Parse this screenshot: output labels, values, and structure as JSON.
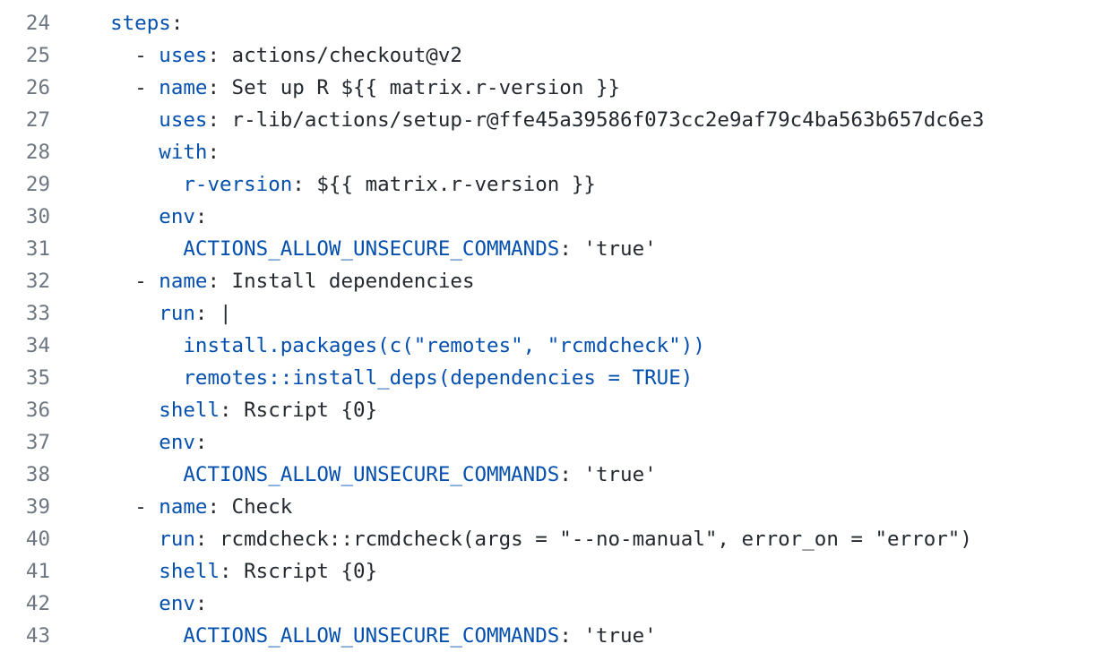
{
  "editor": {
    "lines": [
      {
        "number": "24",
        "indent": "  ",
        "tokens": [
          {
            "t": "steps",
            "k": "key"
          },
          {
            "t": ":",
            "k": "punct"
          }
        ]
      },
      {
        "number": "25",
        "indent": "    ",
        "tokens": [
          {
            "t": "- ",
            "k": "punct"
          },
          {
            "t": "uses",
            "k": "key"
          },
          {
            "t": ": actions/checkout@v2",
            "k": "text"
          }
        ]
      },
      {
        "number": "26",
        "indent": "    ",
        "tokens": [
          {
            "t": "- ",
            "k": "punct"
          },
          {
            "t": "name",
            "k": "key"
          },
          {
            "t": ": Set up R ${{ matrix.r-version }}",
            "k": "text"
          }
        ]
      },
      {
        "number": "27",
        "indent": "      ",
        "tokens": [
          {
            "t": "uses",
            "k": "key"
          },
          {
            "t": ": r-lib/actions/setup-r@ffe45a39586f073cc2e9af79c4ba563b657dc6e3",
            "k": "text"
          }
        ]
      },
      {
        "number": "28",
        "indent": "      ",
        "tokens": [
          {
            "t": "with",
            "k": "key"
          },
          {
            "t": ":",
            "k": "punct"
          }
        ]
      },
      {
        "number": "29",
        "indent": "        ",
        "tokens": [
          {
            "t": "r-version",
            "k": "key"
          },
          {
            "t": ": ${{ matrix.r-version }}",
            "k": "text"
          }
        ]
      },
      {
        "number": "30",
        "indent": "      ",
        "tokens": [
          {
            "t": "env",
            "k": "key"
          },
          {
            "t": ":",
            "k": "punct"
          }
        ]
      },
      {
        "number": "31",
        "indent": "        ",
        "tokens": [
          {
            "t": "ACTIONS_ALLOW_UNSECURE_COMMANDS",
            "k": "key"
          },
          {
            "t": ": 'true'",
            "k": "text"
          }
        ]
      },
      {
        "number": "32",
        "indent": "    ",
        "tokens": [
          {
            "t": "- ",
            "k": "punct"
          },
          {
            "t": "name",
            "k": "key"
          },
          {
            "t": ": Install dependencies",
            "k": "text"
          }
        ]
      },
      {
        "number": "33",
        "indent": "      ",
        "tokens": [
          {
            "t": "run",
            "k": "key"
          },
          {
            "t": ": |",
            "k": "text"
          }
        ]
      },
      {
        "number": "34",
        "indent": "        ",
        "tokens": [
          {
            "t": "install.packages(c(\"remotes\", \"rcmdcheck\"))",
            "k": "key"
          }
        ]
      },
      {
        "number": "35",
        "indent": "        ",
        "tokens": [
          {
            "t": "remotes::install_deps(dependencies = TRUE)",
            "k": "key"
          }
        ]
      },
      {
        "number": "36",
        "indent": "      ",
        "tokens": [
          {
            "t": "shell",
            "k": "key"
          },
          {
            "t": ": ",
            "k": "text"
          },
          {
            "t": "Rscript {0}",
            "k": "squiggle"
          }
        ]
      },
      {
        "number": "37",
        "indent": "      ",
        "tokens": [
          {
            "t": "env",
            "k": "key"
          },
          {
            "t": ":",
            "k": "punct"
          }
        ]
      },
      {
        "number": "38",
        "indent": "        ",
        "tokens": [
          {
            "t": "ACTIONS_ALLOW_UNSECURE_COMMANDS",
            "k": "key"
          },
          {
            "t": ": 'true'",
            "k": "text"
          }
        ]
      },
      {
        "number": "39",
        "indent": "    ",
        "tokens": [
          {
            "t": "- ",
            "k": "punct"
          },
          {
            "t": "name",
            "k": "key"
          },
          {
            "t": ": Check",
            "k": "text"
          }
        ]
      },
      {
        "number": "40",
        "indent": "      ",
        "tokens": [
          {
            "t": "run",
            "k": "key"
          },
          {
            "t": ": rcmdcheck::rcmdcheck(args = \"--no-manual\", error_on = \"error\")",
            "k": "text"
          }
        ]
      },
      {
        "number": "41",
        "indent": "      ",
        "tokens": [
          {
            "t": "shell",
            "k": "key"
          },
          {
            "t": ": ",
            "k": "text"
          },
          {
            "t": "Rscript {0}",
            "k": "squiggle"
          }
        ]
      },
      {
        "number": "42",
        "indent": "      ",
        "tokens": [
          {
            "t": "env",
            "k": "key"
          },
          {
            "t": ":",
            "k": "punct"
          }
        ]
      },
      {
        "number": "43",
        "indent": "        ",
        "tokens": [
          {
            "t": "ACTIONS_ALLOW_UNSECURE_COMMANDS",
            "k": "key"
          },
          {
            "t": ": 'true'",
            "k": "text"
          }
        ]
      }
    ]
  }
}
